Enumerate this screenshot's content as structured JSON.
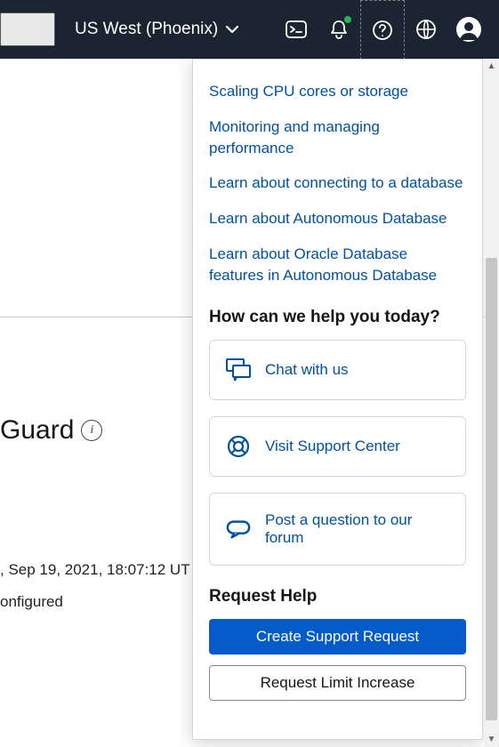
{
  "header": {
    "region": "US West (Phoenix)"
  },
  "content": {
    "heading": "Guard",
    "timestamp": ", Sep 19, 2021, 18:07:12 UT",
    "configured": "onfigured"
  },
  "panel": {
    "links": [
      "Scaling CPU cores or storage",
      "Monitoring and managing performance",
      "Learn about connecting to a database",
      "Learn about Autonomous Database",
      "Learn about Oracle Database features in Autonomous Database"
    ],
    "help_heading": "How can we help you today?",
    "cards": [
      {
        "label": "Chat with us"
      },
      {
        "label": "Visit Support Center"
      },
      {
        "label": "Post a question to our forum"
      }
    ],
    "request_heading": "Request Help",
    "primary_button": "Create Support Request",
    "secondary_button": "Request Limit Increase"
  }
}
